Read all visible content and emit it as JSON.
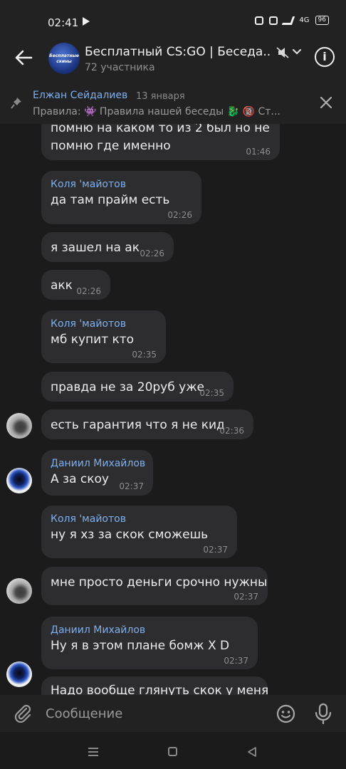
{
  "status_bar": {
    "time": "02:41",
    "battery": "96",
    "network": "4G"
  },
  "header": {
    "title": "Бесплатный CS:GO | Беседа...",
    "subtitle": "72 участника",
    "avatar_line1": "Бесплатные",
    "avatar_line2": "скины"
  },
  "pinned": {
    "author": "Елжан Сейдалиев",
    "date": "13 января",
    "text": "Правила: 👾 Правила нашей беседы 🐉  🔞 Ст..."
  },
  "messages": [
    {
      "author": "",
      "text_lines": [
        "помню на каком то из 2 был но не",
        "помню где именно"
      ],
      "time": "01:46"
    },
    {
      "author": "Коля 'майотов",
      "text_lines": [
        "да там прайм есть"
      ],
      "time": "02:26"
    },
    {
      "author": "",
      "text_lines": [
        "я зашел на ак"
      ],
      "time": "02:26"
    },
    {
      "author": "",
      "text_lines": [
        "акк"
      ],
      "time": "02:26"
    },
    {
      "author": "Коля 'майотов",
      "text_lines": [
        "мб купит кто"
      ],
      "time": "02:35"
    },
    {
      "author": "",
      "text_lines": [
        "правда не за 20руб уже"
      ],
      "time": "02:35"
    },
    {
      "author": "",
      "text_lines": [
        "есть гарантия что я не кид"
      ],
      "time": "02:36"
    },
    {
      "author": "Даниил Михайлов",
      "text_lines": [
        "А за скоу"
      ],
      "time": "02:37"
    },
    {
      "author": "Коля 'майотов",
      "text_lines": [
        "ну я хз за скок сможешь"
      ],
      "time": "02:37"
    },
    {
      "author": "",
      "text_lines": [
        "мне просто деньги срочно нужны"
      ],
      "time": "02:37"
    },
    {
      "author": "Даниил Михайлов",
      "text_lines": [
        "Ну я в этом плане бомж X D"
      ],
      "time": "02:37"
    },
    {
      "author": "",
      "text_lines": [
        "Надо вообще глянуть скок у меня"
      ],
      "time": ""
    }
  ],
  "composer": {
    "placeholder": "Сообщение"
  }
}
